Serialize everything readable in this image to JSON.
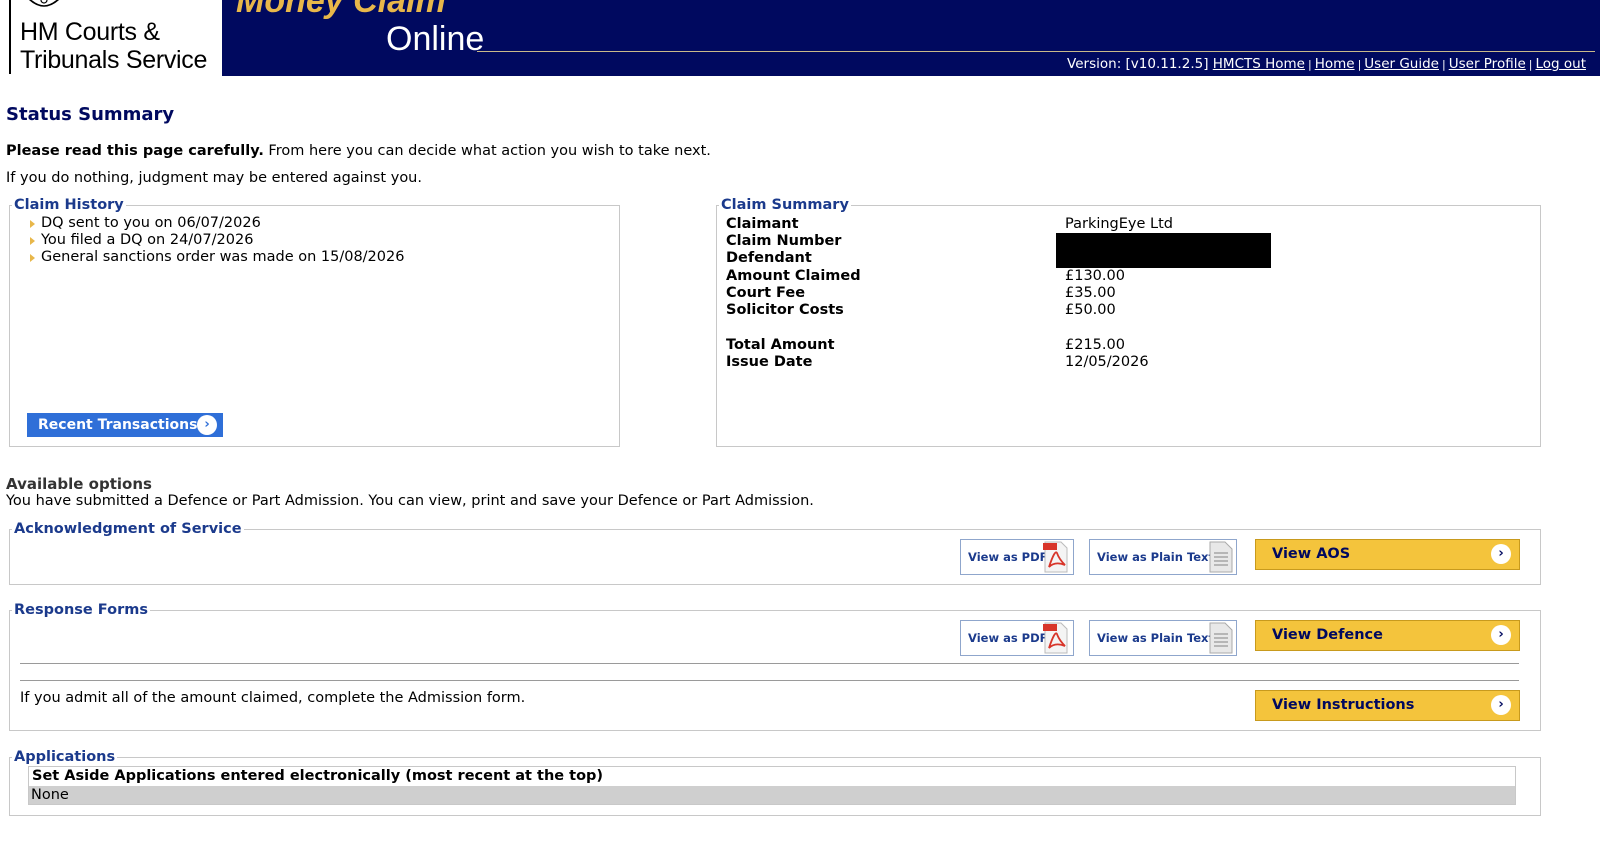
{
  "header": {
    "logo_line1": "HM Courts &",
    "logo_line2": "Tribunals Service",
    "app_name_part1": "Money Claim",
    "app_name_part2": "Online",
    "version": "Version: [v10.11.2.5]",
    "links": [
      "HMCTS Home",
      "Home",
      "User Guide",
      "User Profile",
      "Log out"
    ],
    "brand_color": "#00095f",
    "accent_color": "#e8b74a"
  },
  "page": {
    "title": "Status Summary",
    "intro_bold": "Please read this page carefully.",
    "intro_rest": " From here you can decide what action you wish to take next.",
    "warning": "If you do nothing, judgment may be entered against you."
  },
  "claim_history": {
    "legend": "Claim History",
    "items": [
      "DQ sent to you on 06/07/2026",
      "You filed a DQ on 24/07/2026",
      "General sanctions order was made on 15/08/2026"
    ],
    "button_label": "Recent Transactions",
    "button_icon": "chevron-right-icon"
  },
  "claim_summary": {
    "legend": "Claim Summary",
    "rows": [
      {
        "label": "Claimant",
        "value": "ParkingEye Ltd"
      },
      {
        "label": "Claim Number",
        "value": ""
      },
      {
        "label": "Defendant",
        "value": ""
      },
      {
        "label": "Amount Claimed",
        "value": "£130.00"
      },
      {
        "label": "Court Fee",
        "value": "£35.00"
      },
      {
        "label": "Solicitor Costs",
        "value": "£50.00"
      },
      {
        "label": "Total Amount",
        "value": "£215.00"
      },
      {
        "label": "Issue Date",
        "value": "12/05/2026"
      }
    ]
  },
  "options": {
    "title": "Available options",
    "text": "You have submitted a Defence or Part Admission. You can view, print and save your Defence or Part Admission."
  },
  "aos": {
    "legend": "Acknowledgment of Service",
    "pdf_label": "View as PDF",
    "text_label": "View as Plain Text",
    "view_label": "View AOS"
  },
  "response_forms": {
    "legend": "Response Forms",
    "pdf_label": "View as PDF",
    "text_label": "View as Plain Text",
    "view_label": "View Defence",
    "admit_text": "If you admit all of the amount claimed, complete the Admission form.",
    "instructions_label": "View Instructions"
  },
  "applications": {
    "legend": "Applications",
    "table_header": "Set Aside Applications entered electronically (most recent at the top)",
    "rows": [
      "None"
    ]
  }
}
